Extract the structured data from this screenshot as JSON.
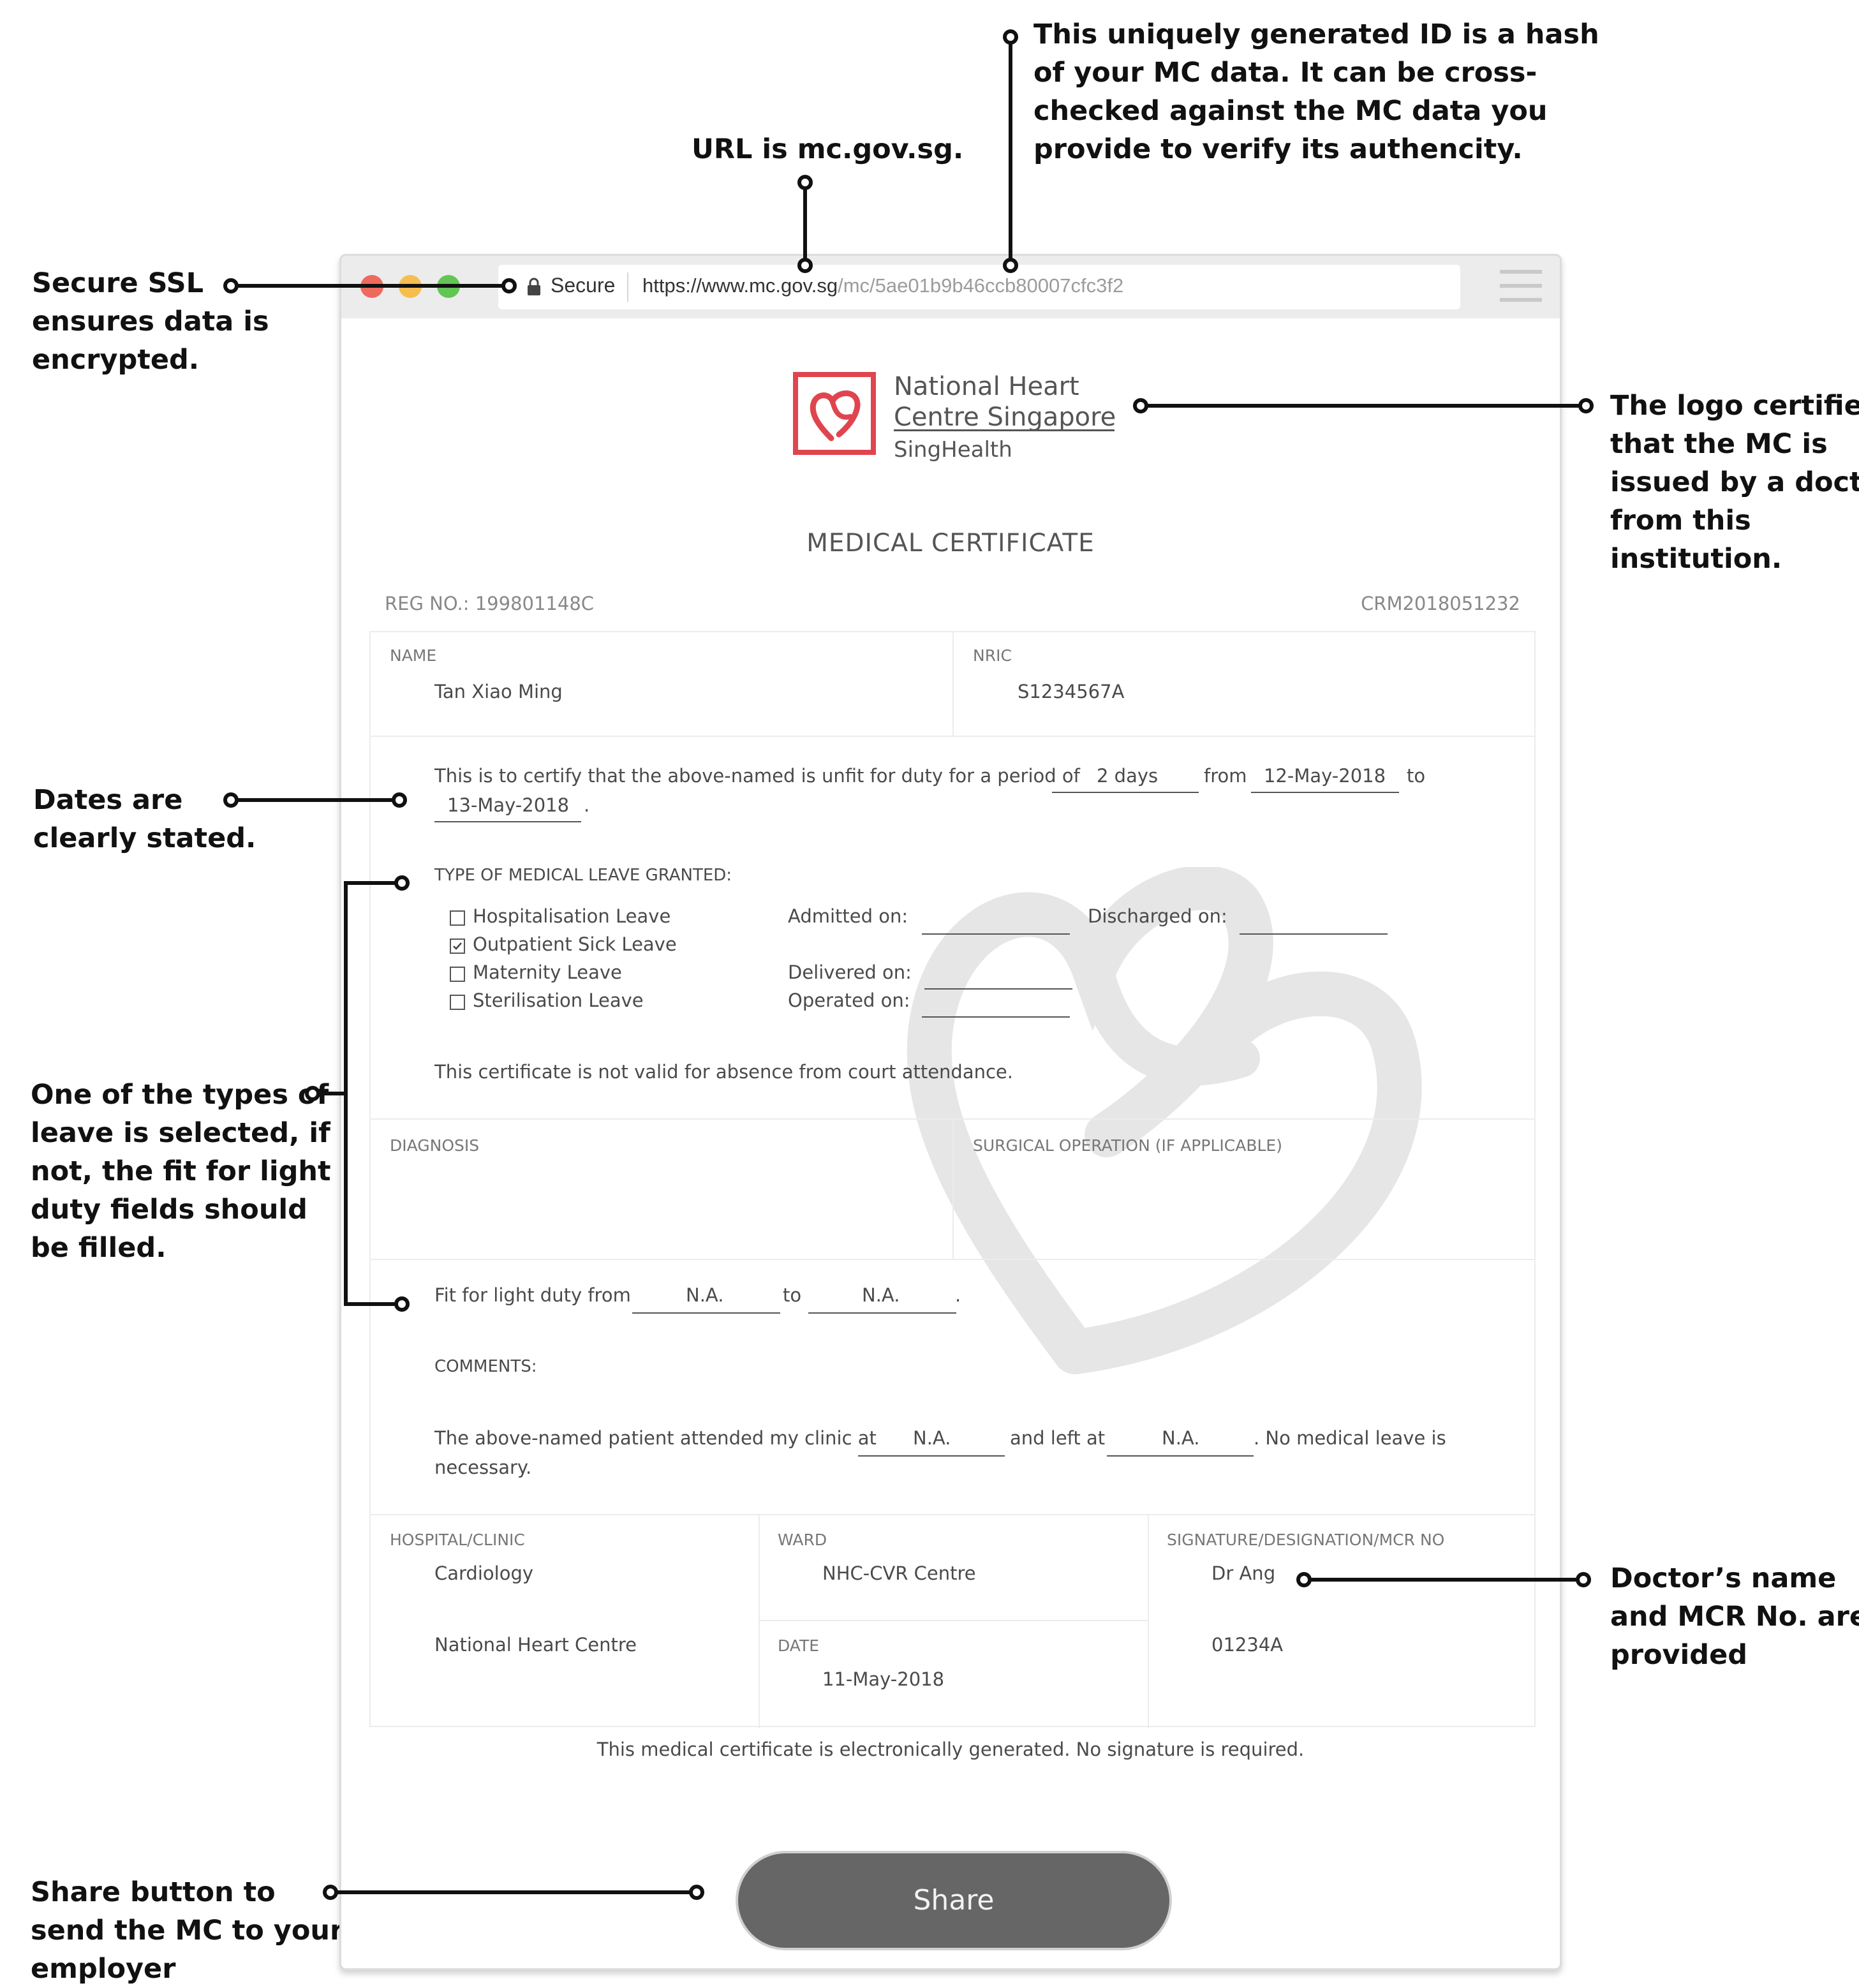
{
  "annotations": {
    "ssl": [
      "Secure SSL",
      "ensures data is",
      "encrypted."
    ],
    "url": [
      "URL is mc.gov.sg."
    ],
    "hash": [
      "This uniquely generated ID is a hash",
      "of your MC data. It can be cross-",
      "checked against the MC data you",
      "provide to verify its authencity."
    ],
    "logo": [
      "The logo certifies",
      "that the MC is",
      "issued by a doctor",
      "from this",
      "institution."
    ],
    "dates": [
      "Dates are",
      "clearly stated."
    ],
    "leave": [
      "One of the types of",
      "leave is selected, if",
      "not, the fit for light",
      "duty fields should",
      "be filled."
    ],
    "doctor": [
      "Doctor’s name",
      "and MCR No. are",
      "provided"
    ],
    "share": [
      "Share button to",
      "send the MC to your",
      "employer"
    ]
  },
  "browser": {
    "secure_label": "Secure",
    "url_host": "https://www.mc.gov.sg",
    "url_path": "/mc/5ae01b9b46ccb80007cfc3f2",
    "traffic_light_colors": [
      "#ee6a5f",
      "#f5be4f",
      "#62c554"
    ]
  },
  "logo": {
    "line1": "National Heart",
    "line2": "Centre Singapore",
    "line3": "SingHealth",
    "color": "#e0454f"
  },
  "certificate": {
    "title": "MEDICAL CERTIFICATE",
    "reg_no": "REG NO.: 199801148C",
    "ref": "CRM2018051232",
    "name_label": "NAME",
    "name": "Tan Xiao Ming",
    "nric_label": "NRIC",
    "nric": "S1234567A",
    "certify_text": "This is to certify that the above-named is unfit for duty for a period of",
    "period": "2 days",
    "from_word": "from",
    "from_date": "12-May-2018",
    "to_word": "to",
    "to_date": "13-May-2018",
    "end_dot": ".",
    "leave_type_label": "TYPE OF MEDICAL LEAVE GRANTED:",
    "leave_types": [
      {
        "label": "Hospitalisation Leave",
        "checked": false
      },
      {
        "label": "Outpatient Sick Leave",
        "checked": true
      },
      {
        "label": "Maternity Leave",
        "checked": false
      },
      {
        "label": "Sterilisation Leave",
        "checked": false
      }
    ],
    "admitted_label": "Admitted on:",
    "discharged_label": "Discharged on:",
    "delivered_label": "Delivered on:",
    "operated_label": "Operated on:",
    "court_note": "This certificate is not valid for absence from court attendance.",
    "diagnosis_label": "DIAGNOSIS",
    "surgical_label": "SURGICAL OPERATION (IF APPLICABLE)",
    "light_duty_text": "Fit for light duty from",
    "light_from": "N.A.",
    "light_to_word": "to",
    "light_to": "N.A.",
    "comments_label": "COMMENTS:",
    "comment_1": "The above-named patient attended my clinic at",
    "clinic_at": "N.A.",
    "comment_2": "and left at",
    "left_at": "N.A.",
    "comment_3": ". No medical leave is",
    "comment_4": "necessary.",
    "hospital_label": "HOSPITAL/CLINIC",
    "department": "Cardiology",
    "hospital": "National Heart Centre",
    "ward_label": "WARD",
    "ward": "NHC-CVR Centre",
    "date_label": "DATE",
    "date": "11-May-2018",
    "signature_label": "SIGNATURE/DESIGNATION/MCR NO",
    "doctor": "Dr Ang",
    "mcr": "01234A",
    "footer_note": "This medical certificate is electronically generated. No signature is required.",
    "share_label": "Share"
  }
}
